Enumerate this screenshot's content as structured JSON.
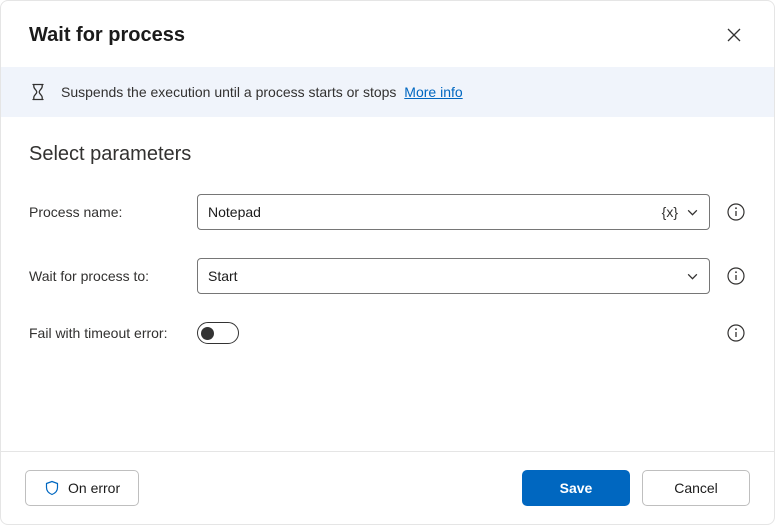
{
  "header": {
    "title": "Wait for process"
  },
  "banner": {
    "description": "Suspends the execution until a process starts or stops",
    "more_info": "More info"
  },
  "section": {
    "title": "Select parameters"
  },
  "fields": {
    "process_name": {
      "label": "Process name:",
      "value": "Notepad"
    },
    "wait_for": {
      "label": "Wait for process to:",
      "value": "Start"
    },
    "timeout": {
      "label": "Fail with timeout error:"
    }
  },
  "footer": {
    "on_error": "On error",
    "save": "Save",
    "cancel": "Cancel"
  }
}
